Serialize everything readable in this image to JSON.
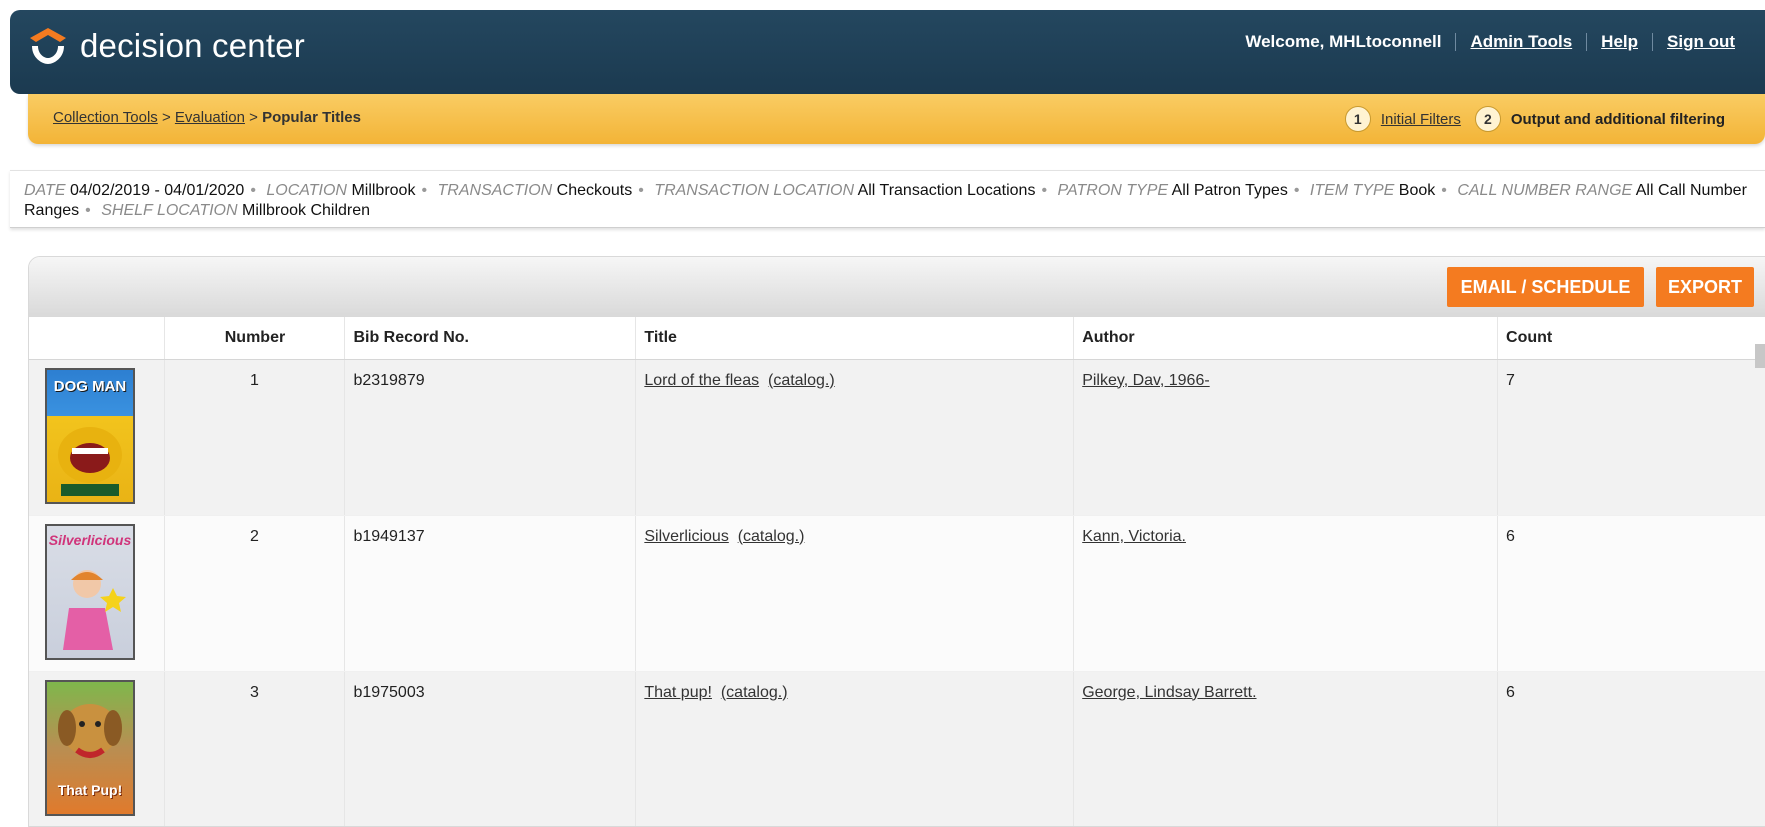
{
  "header": {
    "logo_text": "decision center",
    "welcome": "Welcome, MHLtoconnell",
    "links": {
      "admin": "Admin Tools",
      "help": "Help",
      "signout": "Sign out"
    }
  },
  "breadcrumb": {
    "collection_tools": "Collection Tools",
    "evaluation": "Evaluation",
    "current": "Popular Titles",
    "separator": ">"
  },
  "steps": {
    "step1_num": "1",
    "step1_label": "Initial Filters",
    "step2_num": "2",
    "step2_label": "Output and additional filtering"
  },
  "filters": [
    {
      "key": "DATE",
      "value": "04/02/2019 - 04/01/2020"
    },
    {
      "key": "LOCATION",
      "value": "Millbrook"
    },
    {
      "key": "TRANSACTION",
      "value": "Checkouts"
    },
    {
      "key": "TRANSACTION LOCATION",
      "value": "All Transaction Locations"
    },
    {
      "key": "PATRON TYPE",
      "value": "All Patron Types"
    },
    {
      "key": "ITEM TYPE",
      "value": "Book"
    },
    {
      "key": "CALL NUMBER RANGE",
      "value": "All Call Number Ranges"
    },
    {
      "key": "SHELF LOCATION",
      "value": "Millbrook Children"
    }
  ],
  "filter_separator": "•",
  "buttons": {
    "email_schedule": "EMAIL / SCHEDULE",
    "export": "EXPORT"
  },
  "table": {
    "columns": {
      "number": "Number",
      "bib": "Bib Record No.",
      "title": "Title",
      "author": "Author",
      "count": "Count"
    },
    "catalog_label": "(catalog.)",
    "rows": [
      {
        "number": "1",
        "bib": "b2319879",
        "title": "Lord of the fleas",
        "author": "Pilkey, Dav, 1966-",
        "count": "7",
        "cover": "DOG MAN"
      },
      {
        "number": "2",
        "bib": "b1949137",
        "title": "Silverlicious",
        "author": "Kann, Victoria.",
        "count": "6",
        "cover": "Silverlicious"
      },
      {
        "number": "3",
        "bib": "b1975003",
        "title": "That pup!",
        "author": "George, Lindsay Barrett.",
        "count": "6",
        "cover": "That Pup!"
      }
    ]
  }
}
